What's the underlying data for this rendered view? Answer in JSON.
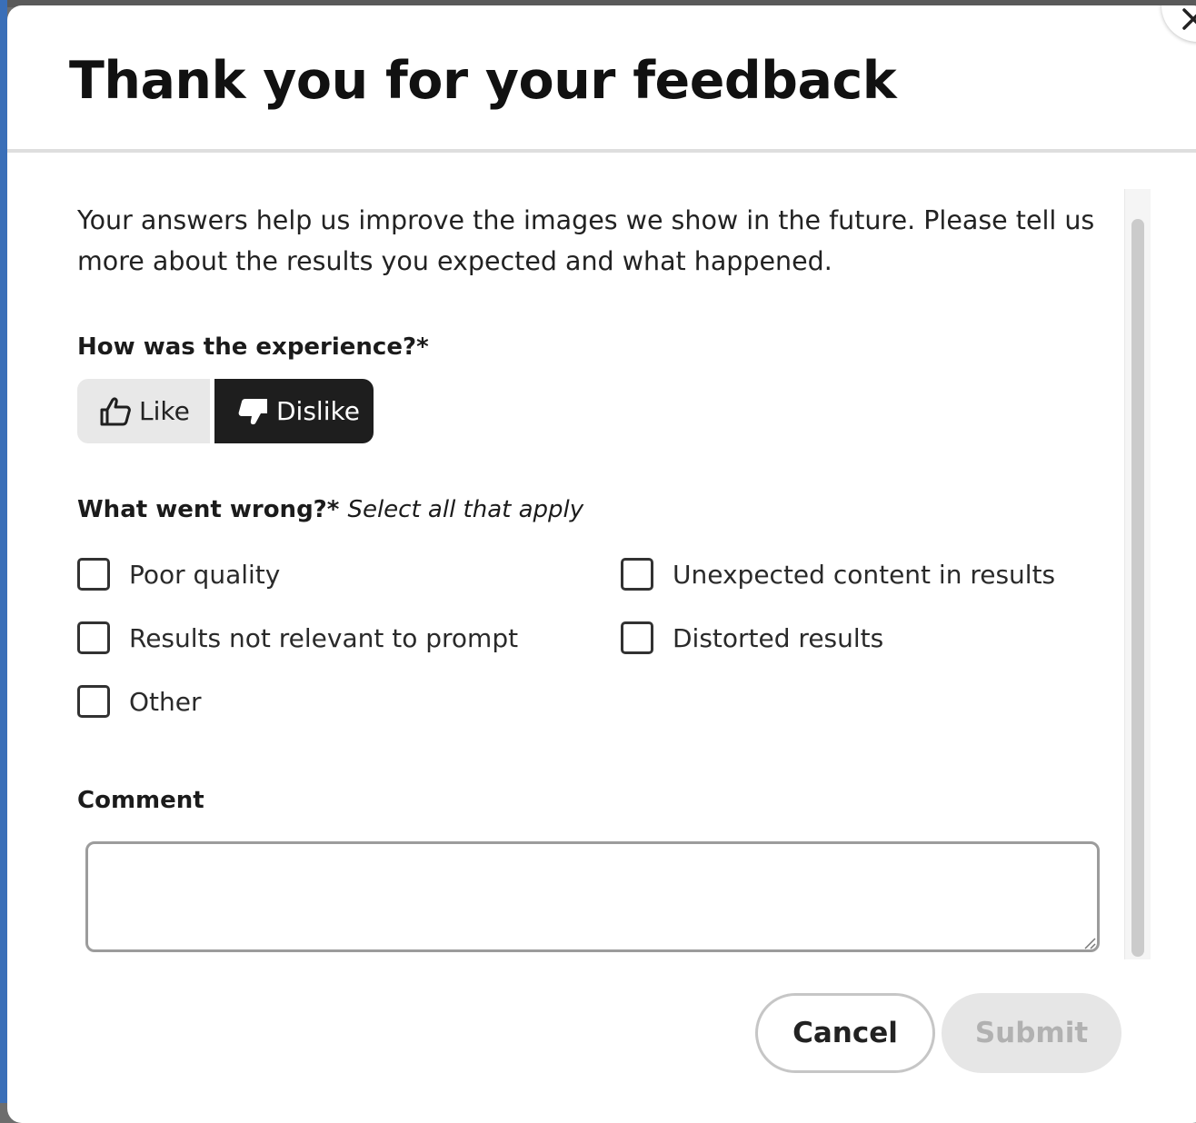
{
  "dialog": {
    "title": "Thank you for your feedback",
    "intro": "Your answers help us improve the images we show in the future. Please tell us more about the results you expected and what happened."
  },
  "experience": {
    "label": "How was the experience?*",
    "options": [
      {
        "label": "Like",
        "icon": "thumbs-up-icon",
        "selected": false
      },
      {
        "label": "Dislike",
        "icon": "thumbs-down-icon",
        "selected": true
      }
    ]
  },
  "issues": {
    "label": "What went wrong?*",
    "hint": "Select all that apply",
    "options": [
      {
        "label": "Poor quality",
        "checked": false
      },
      {
        "label": "Unexpected content in results",
        "checked": false
      },
      {
        "label": "Results not relevant to prompt",
        "checked": false
      },
      {
        "label": "Distorted results",
        "checked": false
      },
      {
        "label": "Other",
        "checked": false
      }
    ]
  },
  "comment": {
    "label": "Comment",
    "value": ""
  },
  "actions": {
    "cancel_label": "Cancel",
    "submit_label": "Submit",
    "submit_enabled": false
  },
  "colors": {
    "selected_segment": "#1e1e1e",
    "unselected_segment": "#e8e8e8",
    "disabled_button": "#e6e6e6"
  }
}
